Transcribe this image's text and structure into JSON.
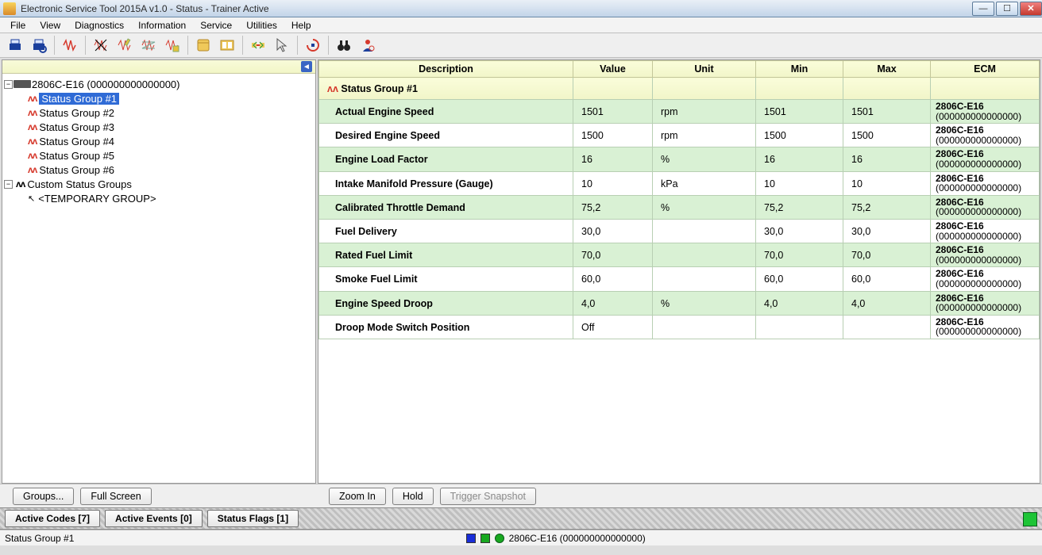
{
  "window": {
    "title": "Electronic Service Tool 2015A v1.0 - Status - Trainer Active"
  },
  "menubar": [
    "File",
    "View",
    "Diagnostics",
    "Information",
    "Service",
    "Utilities",
    "Help"
  ],
  "toolbar_icons": [
    "print-icon",
    "print-preview-icon",
    "wave-icon",
    "wave-x-icon",
    "wave-edit-icon",
    "wave-strike-icon",
    "wave-edit2-icon",
    "book-icon",
    "book-open-icon",
    "transfer-icon",
    "cursor-icon",
    "swirl-icon",
    "binoculars-icon",
    "person-icon"
  ],
  "tree": {
    "root": {
      "label": "2806C-E16 (000000000000000)",
      "groups": [
        "Status Group #1",
        "Status Group #2",
        "Status Group #3",
        "Status Group #4",
        "Status Group #5",
        "Status Group #6"
      ],
      "selected": "Status Group #1"
    },
    "custom": {
      "label": "Custom Status Groups",
      "items": [
        "<TEMPORARY GROUP>"
      ]
    }
  },
  "table": {
    "headers": {
      "description": "Description",
      "value": "Value",
      "unit": "Unit",
      "min": "Min",
      "max": "Max",
      "ecm": "ECM"
    },
    "group_label": "Status Group #1",
    "ecm_name": "2806C-E16",
    "ecm_serial": "(000000000000000)",
    "rows": [
      {
        "desc": "Actual Engine Speed",
        "value": "1501",
        "unit": "rpm",
        "min": "1501",
        "max": "1501"
      },
      {
        "desc": "Desired Engine Speed",
        "value": "1500",
        "unit": "rpm",
        "min": "1500",
        "max": "1500"
      },
      {
        "desc": "Engine Load Factor",
        "value": "16",
        "unit": "%",
        "min": "16",
        "max": "16"
      },
      {
        "desc": "Intake Manifold Pressure (Gauge)",
        "value": "10",
        "unit": "kPa",
        "min": "10",
        "max": "10"
      },
      {
        "desc": "Calibrated Throttle Demand",
        "value": "75,2",
        "unit": "%",
        "min": "75,2",
        "max": "75,2"
      },
      {
        "desc": "Fuel Delivery",
        "value": "30,0",
        "unit": "",
        "min": "30,0",
        "max": "30,0"
      },
      {
        "desc": "Rated Fuel Limit",
        "value": "70,0",
        "unit": "",
        "min": "70,0",
        "max": "70,0"
      },
      {
        "desc": "Smoke Fuel Limit",
        "value": "60,0",
        "unit": "",
        "min": "60,0",
        "max": "60,0"
      },
      {
        "desc": "Engine Speed Droop",
        "value": "4,0",
        "unit": "%",
        "min": "4,0",
        "max": "4,0"
      },
      {
        "desc": "Droop Mode Switch Position",
        "value": "Off",
        "unit": "",
        "min": "",
        "max": ""
      }
    ]
  },
  "buttons": {
    "groups": "Groups...",
    "full_screen": "Full Screen",
    "zoom_in": "Zoom In",
    "hold": "Hold",
    "trigger_snapshot": "Trigger Snapshot"
  },
  "tabs": {
    "active_codes": "Active Codes [7]",
    "active_events": "Active Events [0]",
    "status_flags": "Status Flags [1]"
  },
  "statusbar": {
    "left": "Status Group #1",
    "ecm": "2806C-E16 (000000000000000)"
  }
}
